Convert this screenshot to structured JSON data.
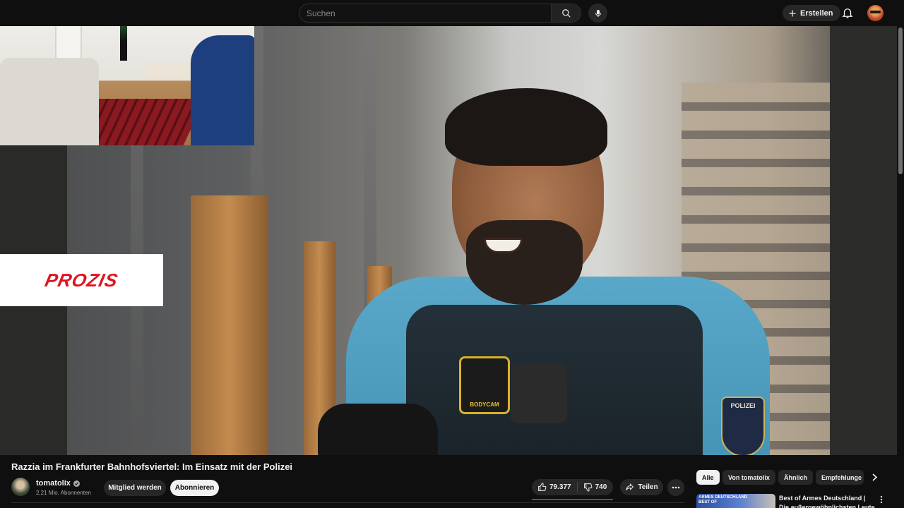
{
  "header": {
    "search_placeholder": "Suchen",
    "create_label": "Erstellen"
  },
  "player": {
    "sponsor_logo_text": "PROZIS",
    "bodycam_text": "BODYCAM",
    "patch_text": "POLIZEI"
  },
  "video": {
    "title": "Razzia im Frankfurter Bahnhofsviertel: Im Einsatz mit der Polizei",
    "channel_name": "tomatolix",
    "subscribers": "2,21 Mio. Abonnenten",
    "member_label": "Mitglied werden",
    "subscribe_label": "Abonnieren",
    "likes": "79.377",
    "dislikes": "740",
    "share_label": "Teilen"
  },
  "sidebar": {
    "chips": [
      {
        "label": "Alle",
        "active": true
      },
      {
        "label": "Von tomatolix",
        "active": false
      },
      {
        "label": "Ähnlich",
        "active": false
      },
      {
        "label": "Empfehlunge",
        "active": false
      }
    ],
    "recommendation": {
      "thumb_text_1": "ARMES DEUTSCHLAND",
      "thumb_text_2": "BEST OF",
      "title": "Best of Armes Deutschland | Die außergewöhnlichsten Leute"
    }
  },
  "colors": {
    "background": "#0f0f0f",
    "pill": "#272727",
    "subscribe_bg": "#f1f1f1",
    "sponsor_red": "#e0141e"
  },
  "icons": [
    "search-icon",
    "mic-icon",
    "plus-icon",
    "bell-icon",
    "like-icon",
    "dislike-icon",
    "share-icon",
    "more-icon",
    "chevron-right-icon",
    "verified-icon",
    "kebab-icon"
  ]
}
